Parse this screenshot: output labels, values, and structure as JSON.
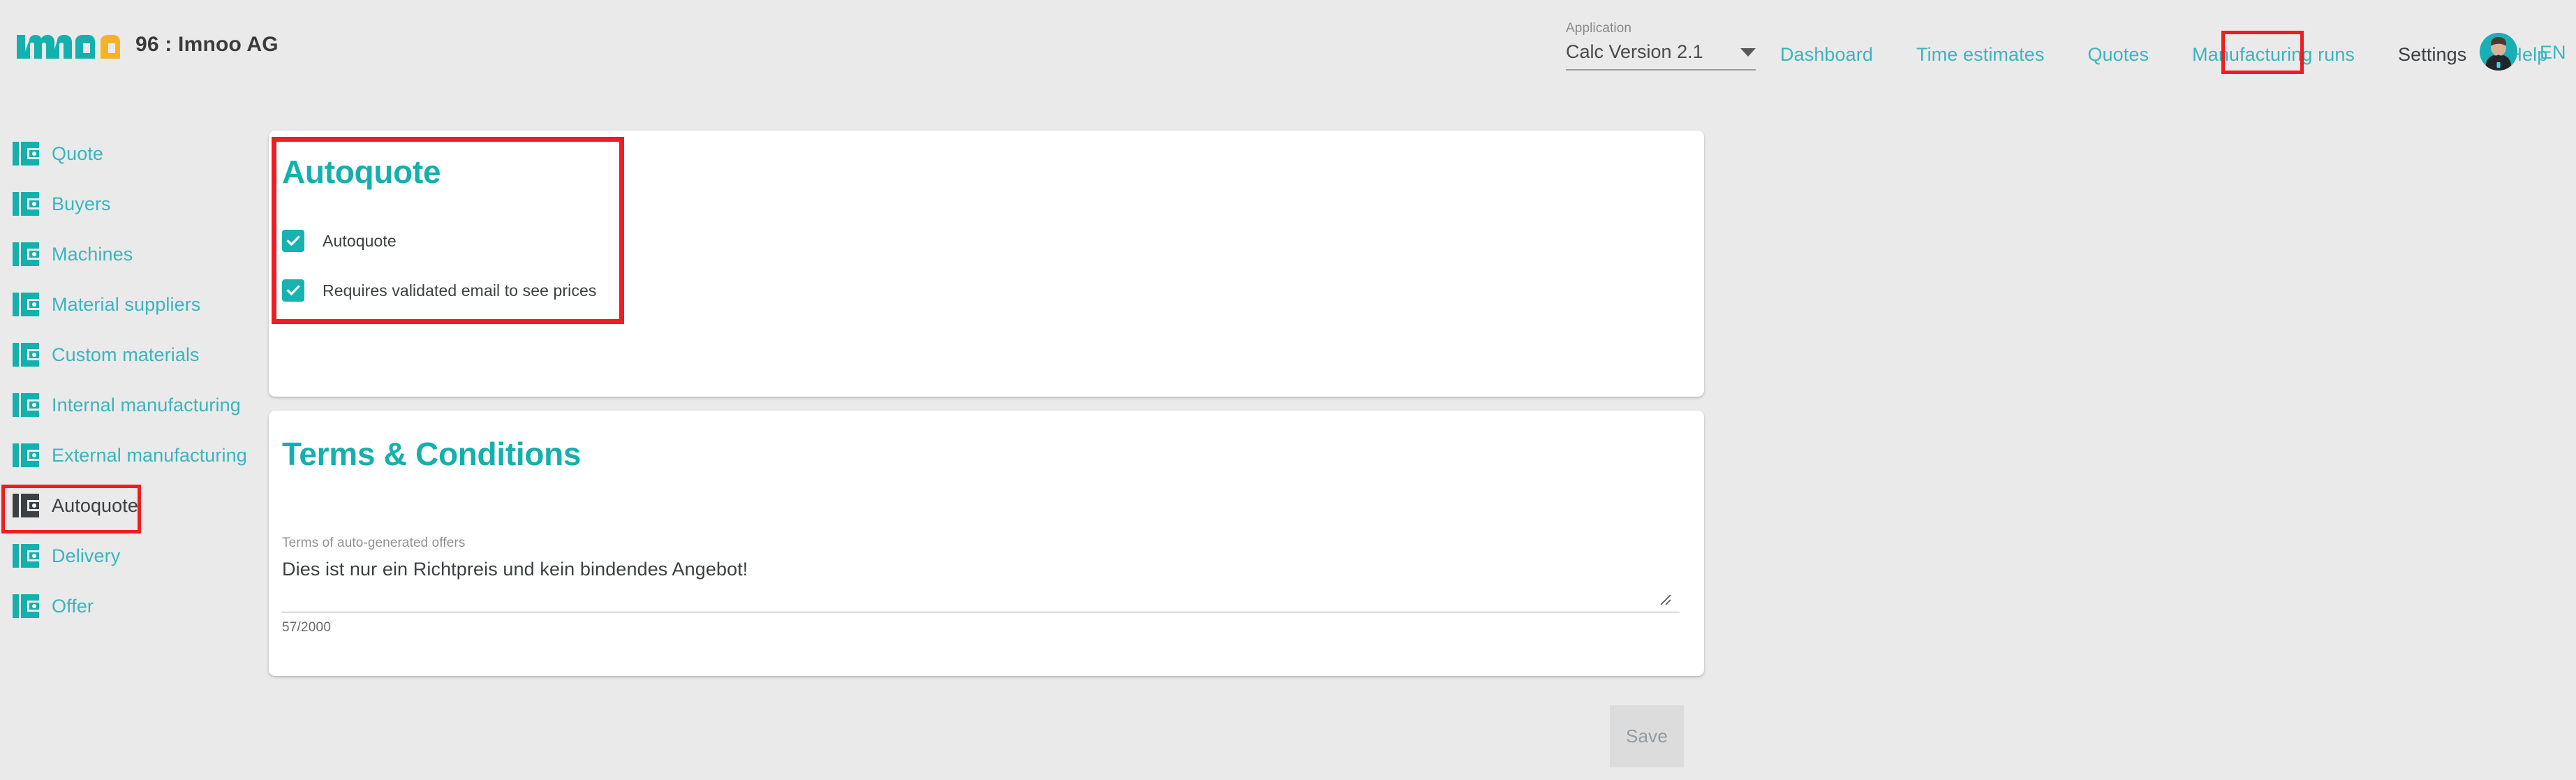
{
  "header": {
    "logo_icon": "imnoo-logo",
    "logo_colors": {
      "primary": "#14b0ad",
      "accent": "#f5b324"
    },
    "brand_name": "96 : Imnoo AG",
    "app_select": {
      "label": "Application",
      "value": "Calc Version 2.1",
      "caret_icon": "chevron-down-icon"
    },
    "nav": [
      {
        "label": "Dashboard",
        "active": false
      },
      {
        "label": "Time estimates",
        "active": false
      },
      {
        "label": "Quotes",
        "active": false
      },
      {
        "label": "Manufacturing runs",
        "active": false
      },
      {
        "label": "Settings",
        "active": true,
        "highlighted": true
      },
      {
        "label": "Help",
        "active": false
      }
    ],
    "avatar_icon": "user-avatar",
    "language": "EN"
  },
  "sidebar": {
    "items": [
      {
        "label": "Quote",
        "icon": "card-icon",
        "active": false
      },
      {
        "label": "Buyers",
        "icon": "card-icon",
        "active": false
      },
      {
        "label": "Machines",
        "icon": "card-icon",
        "active": false
      },
      {
        "label": "Material suppliers",
        "icon": "card-icon",
        "active": false
      },
      {
        "label": "Custom materials",
        "icon": "card-icon",
        "active": false
      },
      {
        "label": "Internal manufacturing",
        "icon": "card-icon",
        "active": false
      },
      {
        "label": "External manufacturing",
        "icon": "card-icon",
        "active": false
      },
      {
        "label": "Autoquote",
        "icon": "card-icon",
        "active": true,
        "highlighted": true
      },
      {
        "label": "Delivery",
        "icon": "card-icon",
        "active": false
      },
      {
        "label": "Offer",
        "icon": "card-icon",
        "active": false
      }
    ]
  },
  "autoquote_card": {
    "title": "Autoquote",
    "checkboxes": [
      {
        "label": "Autoquote",
        "checked": true
      },
      {
        "label": "Requires validated email to see prices",
        "checked": true
      }
    ]
  },
  "terms_card": {
    "title": "Terms & Conditions",
    "field_label": "Terms of auto-generated offers",
    "field_value": "Dies ist nur ein Richtpreis und kein bindendes Angebot!",
    "char_count": "57/2000",
    "resize_icon": "resize-handle-icon"
  },
  "footer": {
    "save_label": "Save",
    "save_disabled": true
  },
  "annotations": {
    "accent_color": "#14b0ad",
    "highlight_color": "#ef1c22"
  }
}
